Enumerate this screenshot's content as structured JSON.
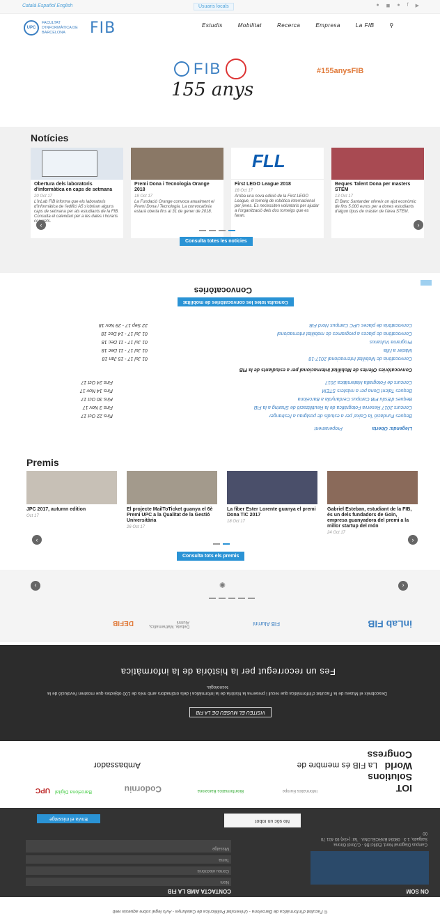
{
  "topbar": {
    "langs": "Català  Español  English",
    "user": "Usuaris locals",
    "icons": [
      "twitter-icon",
      "rss-icon",
      "flickr-icon",
      "facebook-icon",
      "youtube-icon"
    ]
  },
  "header": {
    "logo_text": "FACULTAT D'INFORMÀTICA DE BARCELONA",
    "logo_fib": "FIB",
    "nav": [
      "Estudis",
      "Mobilitat",
      "Recerca",
      "Empresa",
      "La FIB"
    ]
  },
  "banner": {
    "fib": "FIB",
    "num": "155 anys",
    "hashtag": "#155anysFIB"
  },
  "news": {
    "title": "Notícies",
    "cards": [
      {
        "title": "Obertura dels laboratoris d'informàtica en caps de setmana",
        "date": "20 Oct 17",
        "excerpt": "L'inLab FIB informa que els laboratoris d'informàtica de l'edifici A5 s'obriran alguns caps de setmana per als estudiants de la FIB. Consulta el calendari per a les dates i horaris concrets."
      },
      {
        "title": "Premi Dona i Tecnologia Orange 2018",
        "date": "18 Oct 17",
        "excerpt": "La Fundació Orange convoca anualment el Premi Dona i Tecnologia. La convocatòria estarà oberta fins al 31 de gener de 2018."
      },
      {
        "title": "First LEGO League 2018",
        "date": "18 Oct 17",
        "excerpt": "Arriba una nova edició de la First LEGO League, el torneig de robòtica internacional per joves. Es necessiten voluntaris per ajudar a l'organització dels dos torneigs que es faran."
      },
      {
        "title": "Beques Talent Dona per masters STEM",
        "date": "13 Oct 17",
        "excerpt": "El Banc Santander ofereix un ajut econòmic de fins 5.000 euros per a dones estudiants d'algun tipus de màster de l'àrea STEM."
      }
    ],
    "more": "Consulta totes les notícies"
  },
  "conv": {
    "title": "Convocatòries",
    "tabs": [
      "Llegenda: Oberta",
      "Properament"
    ],
    "section": "Convocatòries Ofertes de Mobilitat Internacional per a estudiants de la FIB",
    "items": [
      {
        "text": "Beques Fundació 'la Caixa' per a estudis de postgrau a l'estranger",
        "date": "Fins 22 Oct 17"
      },
      {
        "text": "Concurs 2017 Reserva Fotogràfica de la Reutilització de Sharing a la FIB",
        "date": "Fins 3 Nov 17"
      },
      {
        "text": "Beques d'Estiu FIB Campus Cerdanyola a Barcelona",
        "date": "Fins 30 Oct 17"
      },
      {
        "text": "Beques Talent Dona per a màsters STEM",
        "date": "Fins 14 Nov 17"
      },
      {
        "text": "Concurs de Fotografia Matemàtica 2017",
        "date": "Fins 24 Oct 17"
      }
    ],
    "items2": [
      {
        "text": "Convocatòria de Mobilitat Internacional 2017-18",
        "date": "01 Jul 17 - 15 Jan 18"
      },
      {
        "text": "Màster a l'Illa",
        "date": "01 Jul 17 - 11 Dec 18"
      },
      {
        "text": "Programa Vulcanus",
        "date": "01 Jul 17 - 11 Dec 18"
      },
      {
        "text": "Convocatòria de places a programes de mobilitat internacional",
        "date": "01 Jul 17 - 14 Dec 18"
      },
      {
        "text": "Convocatòria de places UPC Campus Nord FIB",
        "date": "22 Sep 17 - 29 Nov 18"
      }
    ],
    "more": "Consulta totes les convocatòries de mobilitat"
  },
  "premis": {
    "title": "Premis",
    "cards": [
      {
        "title": "JPC 2017, autumn edition",
        "date": "Oct 17"
      },
      {
        "title": "El projecte MailToTicket guanya el 6è Premi UPC a la Qualitat de la Gestió Universitària",
        "date": "26 Oct 17"
      },
      {
        "title": "La fiber Ester Lorente guanya el premi Dona TIC 2017",
        "date": "18 Oct 17"
      },
      {
        "title": "Gabriel Esteban, estudiant de la FIB, és un dels fundadors de Goin, empresa guanyadora del premi a la millor startup del món",
        "date": "24 Oct 17"
      }
    ],
    "more": "Consulta tots els premis"
  },
  "partners": {
    "items": [
      "inLab FIB",
      "FIB Alumni",
      "Debate, Mathematics, Alumni",
      "DEFIB"
    ]
  },
  "dark": {
    "title": "Fes un recorregut per la història de la informàtica",
    "subtitle": "Descobreix el Museu de la Facultat d'Informàtica que recull i preserva la història de la informàtica i dels ordinadors amb més de 100 objectes que mostren l'evolució de la tecnologia.",
    "btn": "VISITEU EL MUSEU DE LA FIB"
  },
  "amb": {
    "title": "La FIB és membre de",
    "sub": "Ambassador",
    "logos": [
      "IOT Solutions World Congress",
      "Informatics Europe",
      "Bioinformatics Barcelona",
      "Codorniu",
      "Barcelona Digital",
      "UPC"
    ]
  },
  "footer": {
    "on": "ON SOM",
    "contact": "CONTACTA AMB LA FIB",
    "address": "Campus Diagonal Nord, Edifici B6 · C/Jordi Girona Salgado, 1-3 · 08034 BARCELONA · Tel: (+34) 93 401 70 00",
    "form_name": "Nom",
    "form_email": "Correu electrònic",
    "form_message": "Missatge",
    "form_topic": "Tema",
    "captcha": "No sóc un robot",
    "submit": "Envia el missatge"
  },
  "copyright": "© Facultat d'Informàtica de Barcelona - Universitat Politècnica de Catalunya - Avís legal sobre aquesta web"
}
